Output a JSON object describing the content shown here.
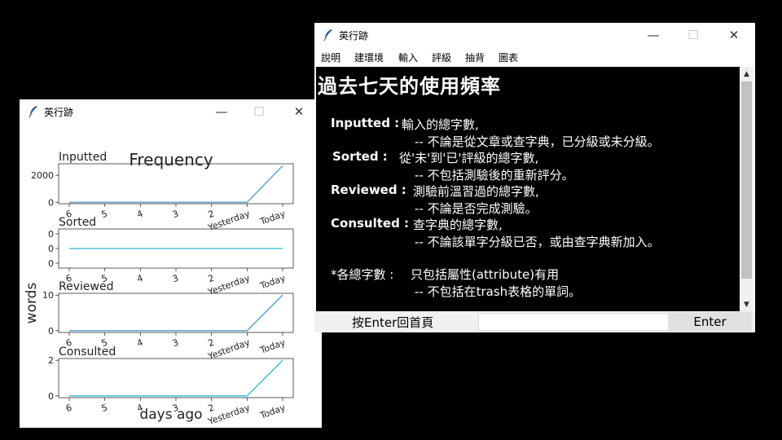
{
  "chart_window": {
    "title": "英行跡",
    "controls": {
      "minimize": "—",
      "maximize": "☐",
      "close": "✕"
    }
  },
  "text_window": {
    "title": "英行跡",
    "controls": {
      "minimize": "—",
      "maximize": "☐",
      "close": "✕"
    },
    "menu": [
      "說明",
      "建環境",
      "輸入",
      "評級",
      "抽背",
      "圖表"
    ],
    "heading": "過去七天的使用頻率",
    "lines": [
      {
        "label": "Inputted :",
        "text": "輸入的總字數,"
      },
      {
        "label": "",
        "text": "-- 不論是從文章或查字典，已分級或未分級。"
      },
      {
        "label": "Sorted :",
        "text": "從'未'到'已'評級的總字數,"
      },
      {
        "label": "",
        "text": "-- 不包括測驗後的重新評分。"
      },
      {
        "label": "Reviewed :",
        "text": "測驗前溫習過的總字數,"
      },
      {
        "label": "",
        "text": "-- 不論是否完成測驗。"
      },
      {
        "label": "Consulted :",
        "text": "查字典的總字數,"
      },
      {
        "label": "",
        "text": "-- 不論該單字分級已否，或由查字典新加入。"
      },
      {
        "label": "*各總字數 :",
        "text": "只包括屬性(attribute)有用"
      },
      {
        "label": "",
        "text": "-- 不包括在trash表格的單詞。"
      }
    ],
    "bottom_label": "按Enter回首頁",
    "entry_value": "",
    "enter_button": "Enter"
  },
  "chart_data": {
    "type": "line",
    "title": "Frequency",
    "xlabel": "days ago",
    "ylabel": "words",
    "categories": [
      "6",
      "5",
      "4",
      "3",
      "2",
      "Yesterday",
      "Today"
    ],
    "color": "#6aabd2",
    "series": [
      {
        "name": "Inputted",
        "values": [
          0,
          0,
          0,
          0,
          0,
          0,
          2700
        ],
        "ylim": [
          -100,
          2850
        ],
        "yticks": [
          {
            "v": 0,
            "t": "0"
          },
          {
            "v": 2000,
            "t": "2000"
          }
        ]
      },
      {
        "name": "Sorted",
        "values": [
          0,
          0,
          0,
          0,
          0,
          0,
          0
        ],
        "ylim": [
          -0.06,
          0.06
        ],
        "yticks": [
          {
            "v": -0.045,
            "t": "0"
          },
          {
            "v": 0,
            "t": "0"
          },
          {
            "v": 0.045,
            "t": "0"
          }
        ]
      },
      {
        "name": "Reviewed",
        "values": [
          0,
          0,
          0,
          0,
          0,
          0,
          10
        ],
        "ylim": [
          -0.5,
          10.5
        ],
        "yticks": [
          {
            "v": 0,
            "t": "0"
          },
          {
            "v": 10,
            "t": "10"
          }
        ]
      },
      {
        "name": "Consulted",
        "values": [
          0,
          0,
          0,
          0,
          0,
          0,
          2
        ],
        "ylim": [
          -0.1,
          2.1
        ],
        "yticks": [
          {
            "v": 0,
            "t": "0"
          },
          {
            "v": 2,
            "t": "2"
          }
        ]
      }
    ]
  }
}
